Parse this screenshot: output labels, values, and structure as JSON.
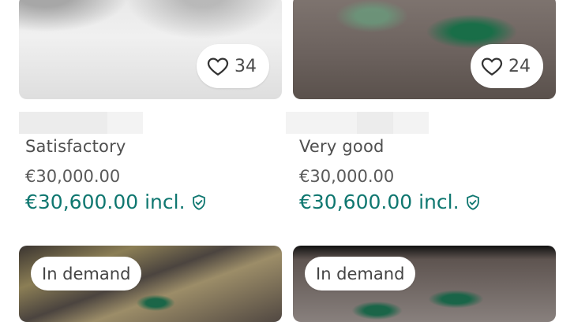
{
  "listings": [
    {
      "favorites": "34",
      "condition": "Satisfactory",
      "price": "€30,000.00",
      "price_incl": "€30,600.00 incl."
    },
    {
      "favorites": "24",
      "condition": "Very good",
      "price": "€30,000.00",
      "price_incl": "€30,600.00 incl."
    },
    {
      "badge": "In demand"
    },
    {
      "badge": "In demand"
    }
  ],
  "colors": {
    "accent": "#0f7770",
    "text_secondary": "#4f4f4f"
  },
  "icons": {
    "favorite": "heart-outline-icon",
    "buyer_protection": "shield-check-icon"
  }
}
